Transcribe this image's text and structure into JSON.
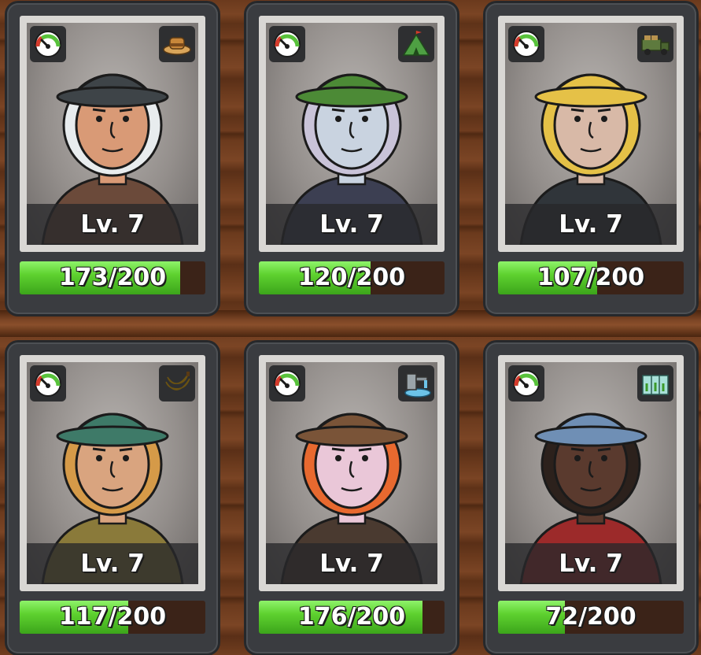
{
  "cards": [
    {
      "level": "Lv. 7",
      "health_text": "173/200",
      "health": 173,
      "health_max": 200,
      "trait_icon": "straw-hat-icon",
      "skin": "#d99a76",
      "hair": "#e8ecee",
      "hat": "#3e4448"
    },
    {
      "level": "Lv. 7",
      "health_text": "120/200",
      "health": 120,
      "health_max": 200,
      "trait_icon": "tent-icon",
      "skin": "#c9d3e0",
      "hair": "#c9c3d8",
      "hat": "#4c8a36"
    },
    {
      "level": "Lv. 7",
      "health_text": "107/200",
      "health": 107,
      "health_max": 200,
      "trait_icon": "truck-icon",
      "skin": "#d8b9a7",
      "hair": "#e5c147",
      "hat": "#e5c147"
    },
    {
      "level": "Lv. 7",
      "health_text": "117/200",
      "health": 117,
      "health_max": 200,
      "trait_icon": "banana-icon",
      "skin": "#d9a47f",
      "hair": "#d59a48",
      "hat": "#3e7a68"
    },
    {
      "level": "Lv. 7",
      "health_text": "176/200",
      "health": 176,
      "health_max": 200,
      "trait_icon": "water-pump-icon",
      "skin": "#eac7d8",
      "hair": "#e8692f",
      "hat": "#7a5438"
    },
    {
      "level": "Lv. 7",
      "health_text": "72/200",
      "health": 72,
      "health_max": 200,
      "trait_icon": "greenhouse-icon",
      "skin": "#5a3a2e",
      "hair": "#2c211c",
      "hat": "#6f8fb5"
    }
  ],
  "status_icon": "happiness-gauge-icon",
  "colors": {
    "health_fill": "#5ed12f",
    "card_bg": "#3a3c40"
  }
}
